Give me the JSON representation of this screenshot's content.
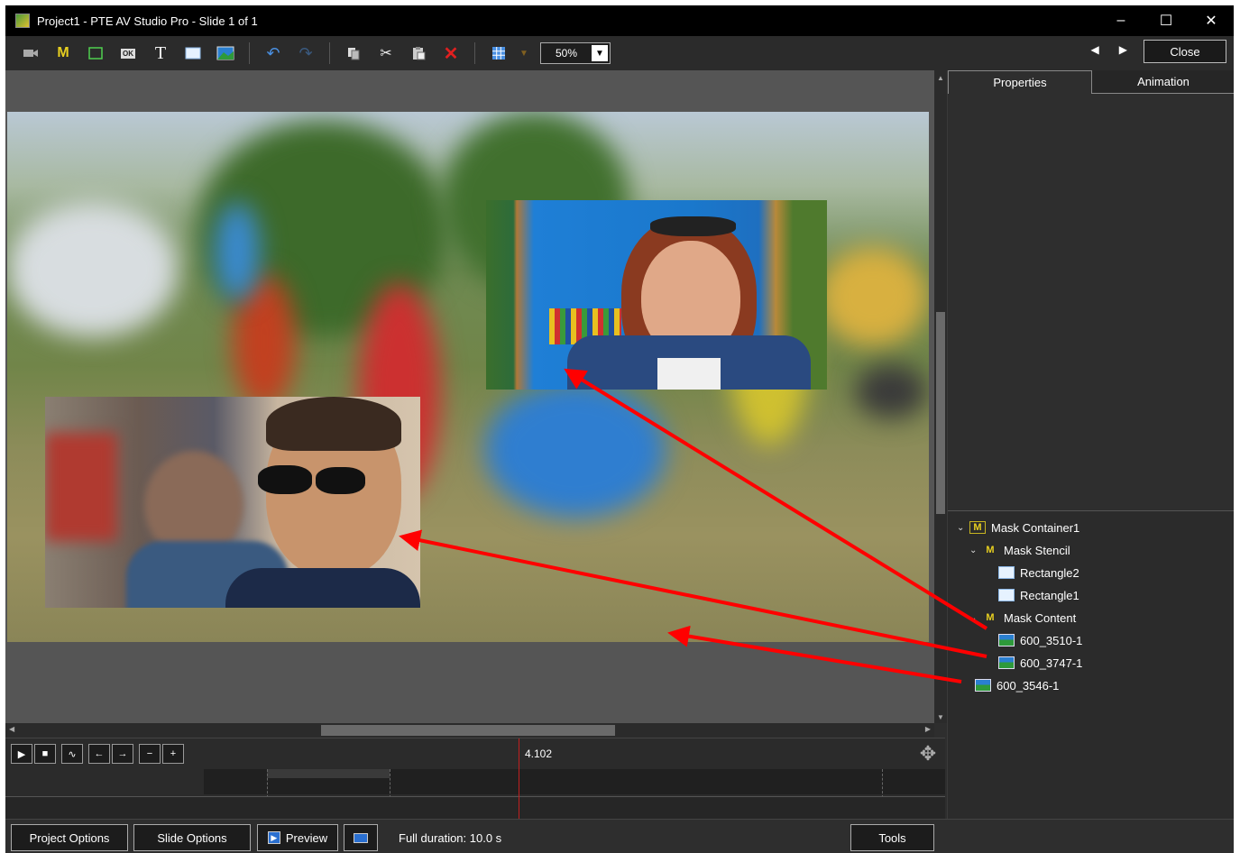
{
  "window": {
    "title": "Project1 - PTE AV Studio Pro - Slide 1 of 1",
    "minimize": "–",
    "maximize": "☐",
    "close": "✕"
  },
  "toolbar": {
    "icons": [
      "camera-icon",
      "mask-icon",
      "frame-icon",
      "button-icon",
      "text-icon",
      "rectangle-icon",
      "image-icon",
      "undo-icon",
      "redo-icon",
      "copy-icon",
      "cut-icon",
      "paste-icon",
      "delete-icon",
      "grid-icon"
    ],
    "text_tool": "T",
    "mask_tool": "M",
    "button_tool": "OK",
    "zoom": "50%",
    "close_label": "Close"
  },
  "timeline": {
    "time": "4.102"
  },
  "panel": {
    "tab_properties": "Properties",
    "tab_animation": "Animation"
  },
  "tree": {
    "nodes": [
      {
        "label": "Mask Container1",
        "icon": "mask-container-icon"
      },
      {
        "label": "Mask Stencil",
        "icon": "mask-stencil-icon"
      },
      {
        "label": "Rectangle2",
        "icon": "rectangle-icon"
      },
      {
        "label": "Rectangle1",
        "icon": "rectangle-icon"
      },
      {
        "label": "Mask Content",
        "icon": "mask-content-icon"
      },
      {
        "label": "600_3510-1",
        "icon": "image-icon"
      },
      {
        "label": "600_3747-1",
        "icon": "image-icon"
      },
      {
        "label": "600_3546-1",
        "icon": "image-icon"
      }
    ]
  },
  "bottom": {
    "project_options": "Project Options",
    "slide_options": "Slide Options",
    "preview": "Preview",
    "duration": "Full duration: 10.0 s",
    "tools": "Tools"
  },
  "colors": {
    "arrow": "#ff0000",
    "accent_yellow": "#e8d020",
    "cursor": "#c02020"
  }
}
